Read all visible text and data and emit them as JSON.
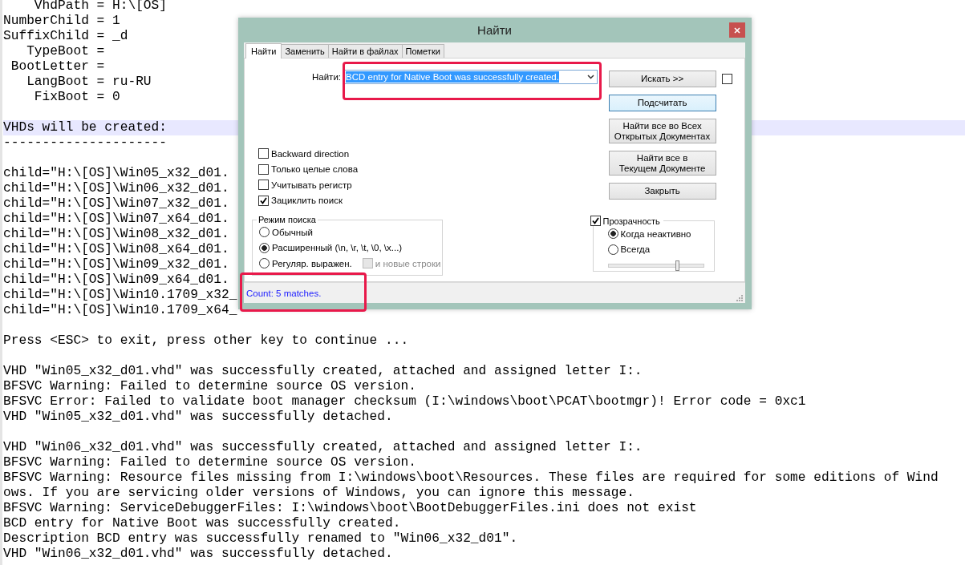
{
  "editor": {
    "lines": [
      {
        "kind": "text",
        "text": "    VhdPath = H:\\[OS]",
        "highlighted": false
      },
      {
        "kind": "text",
        "text": "NumberChild = 1",
        "highlighted": false
      },
      {
        "kind": "text",
        "text": "SuffixChild = _d",
        "highlighted": false
      },
      {
        "kind": "text",
        "text": "   TypeBoot =",
        "highlighted": false
      },
      {
        "kind": "text",
        "text": " BootLetter =",
        "highlighted": false
      },
      {
        "kind": "text",
        "text": "   LangBoot = ru-RU",
        "highlighted": false
      },
      {
        "kind": "text",
        "text": "    FixBoot = 0",
        "highlighted": false
      },
      {
        "kind": "blank"
      },
      {
        "kind": "text",
        "text": "VHDs will be created:",
        "highlighted": true
      },
      {
        "kind": "text",
        "text": "---------------------",
        "highlighted": false
      },
      {
        "kind": "blank"
      },
      {
        "kind": "text",
        "text": "child=\"H:\\[OS]\\Win05_x32_d01.",
        "highlighted": false
      },
      {
        "kind": "text",
        "text": "child=\"H:\\[OS]\\Win06_x32_d01.",
        "highlighted": false
      },
      {
        "kind": "text",
        "text": "child=\"H:\\[OS]\\Win07_x32_d01.",
        "highlighted": false
      },
      {
        "kind": "text",
        "text": "child=\"H:\\[OS]\\Win07_x64_d01.",
        "highlighted": false
      },
      {
        "kind": "text",
        "text": "child=\"H:\\[OS]\\Win08_x32_d01.",
        "highlighted": false
      },
      {
        "kind": "text",
        "text": "child=\"H:\\[OS]\\Win08_x64_d01.",
        "highlighted": false
      },
      {
        "kind": "text",
        "text": "child=\"H:\\[OS]\\Win09_x32_d01.",
        "highlighted": false
      },
      {
        "kind": "text",
        "text": "child=\"H:\\[OS]\\Win09_x64_d01.",
        "highlighted": false
      },
      {
        "kind": "text",
        "text": "child=\"H:\\[OS]\\Win10.1709_x32_",
        "highlighted": false
      },
      {
        "kind": "text",
        "text": "child=\"H:\\[OS]\\Win10.1709_x64_",
        "highlighted": false
      },
      {
        "kind": "blank"
      },
      {
        "kind": "text",
        "text": "Press <ESC> to exit, press other key to continue ...",
        "highlighted": false
      },
      {
        "kind": "blank"
      },
      {
        "kind": "text",
        "text": "VHD \"Win05_x32_d01.vhd\" was successfully created, attached and assigned letter I:.",
        "highlighted": false
      },
      {
        "kind": "text",
        "text": "BFSVC Warning: Failed to determine source OS version.",
        "highlighted": false
      },
      {
        "kind": "text",
        "text": "BFSVC Error: Failed to validate boot manager checksum (I:\\windows\\boot\\PCAT\\bootmgr)! Error code = 0xc1",
        "highlighted": false
      },
      {
        "kind": "text",
        "text": "VHD \"Win05_x32_d01.vhd\" was successfully detached.",
        "highlighted": false
      },
      {
        "kind": "blank"
      },
      {
        "kind": "text",
        "text": "VHD \"Win06_x32_d01.vhd\" was successfully created, attached and assigned letter I:.",
        "highlighted": false
      },
      {
        "kind": "text",
        "text": "BFSVC Warning: Failed to determine source OS version.",
        "highlighted": false
      },
      {
        "kind": "text",
        "text": "BFSVC Warning: Resource files missing from I:\\windows\\boot\\Resources. These files are required for some editions of Wind",
        "highlighted": false
      },
      {
        "kind": "text",
        "text": "ows. If you are servicing older versions of Windows, you can ignore this message.",
        "highlighted": false
      },
      {
        "kind": "text",
        "text": "BFSVC Warning: ServiceDebuggerFiles: I:\\windows\\boot\\BootDebuggerFiles.ini does not exist",
        "highlighted": false
      },
      {
        "kind": "text",
        "text": "BCD entry for Native Boot was successfully created.",
        "highlighted": false
      },
      {
        "kind": "text",
        "text": "Description BCD entry was successfully renamed to \"Win06_x32_d01\".",
        "highlighted": false
      },
      {
        "kind": "text",
        "text": "VHD \"Win06_x32_d01.vhd\" was successfully detached.",
        "highlighted": false
      }
    ]
  },
  "dialog": {
    "title": "Найти",
    "tabs": [
      {
        "label": "Найти",
        "selected": true
      },
      {
        "label": "Заменить",
        "selected": false
      },
      {
        "label": "Найти в файлах",
        "selected": false
      },
      {
        "label": "Пометки",
        "selected": false
      }
    ],
    "find": {
      "label": "Найти:",
      "value": "BCD entry for Native Boot was successfully created."
    },
    "buttons": [
      {
        "label": "Искать >>",
        "focused": false
      },
      {
        "label": "Подсчитать",
        "focused": true
      },
      {
        "label": "Найти все во Всех\nОткрытых Документах",
        "focused": false
      },
      {
        "label": "Найти все в\nТекущем Документе",
        "focused": false
      },
      {
        "label": "Закрыть",
        "focused": false
      }
    ],
    "side_checkbox": {
      "checked": false
    },
    "options": [
      {
        "label": "Backward direction",
        "checked": false
      },
      {
        "label": "Только целые слова",
        "checked": false
      },
      {
        "label": "Учитывать регистр",
        "checked": false
      },
      {
        "label": "Зациклить поиск",
        "checked": true
      }
    ],
    "search_mode": {
      "title": "Режим поиска",
      "options": [
        {
          "label": "Обычный",
          "selected": false
        },
        {
          "label": "Расширенный (\\n, \\r, \\t, \\0, \\x...)",
          "selected": true
        },
        {
          "label": "Регуляр. выражен.",
          "selected": false
        }
      ],
      "newline_option": {
        "label": "и новые строки",
        "checked": false,
        "disabled": true
      }
    },
    "transparency": {
      "label": "Прозрачность",
      "checked": true,
      "options": [
        {
          "label": "Когда неактивно",
          "selected": true
        },
        {
          "label": "Всегда",
          "selected": false
        }
      ],
      "level": 0.72
    },
    "status": "Count: 5 matches."
  }
}
